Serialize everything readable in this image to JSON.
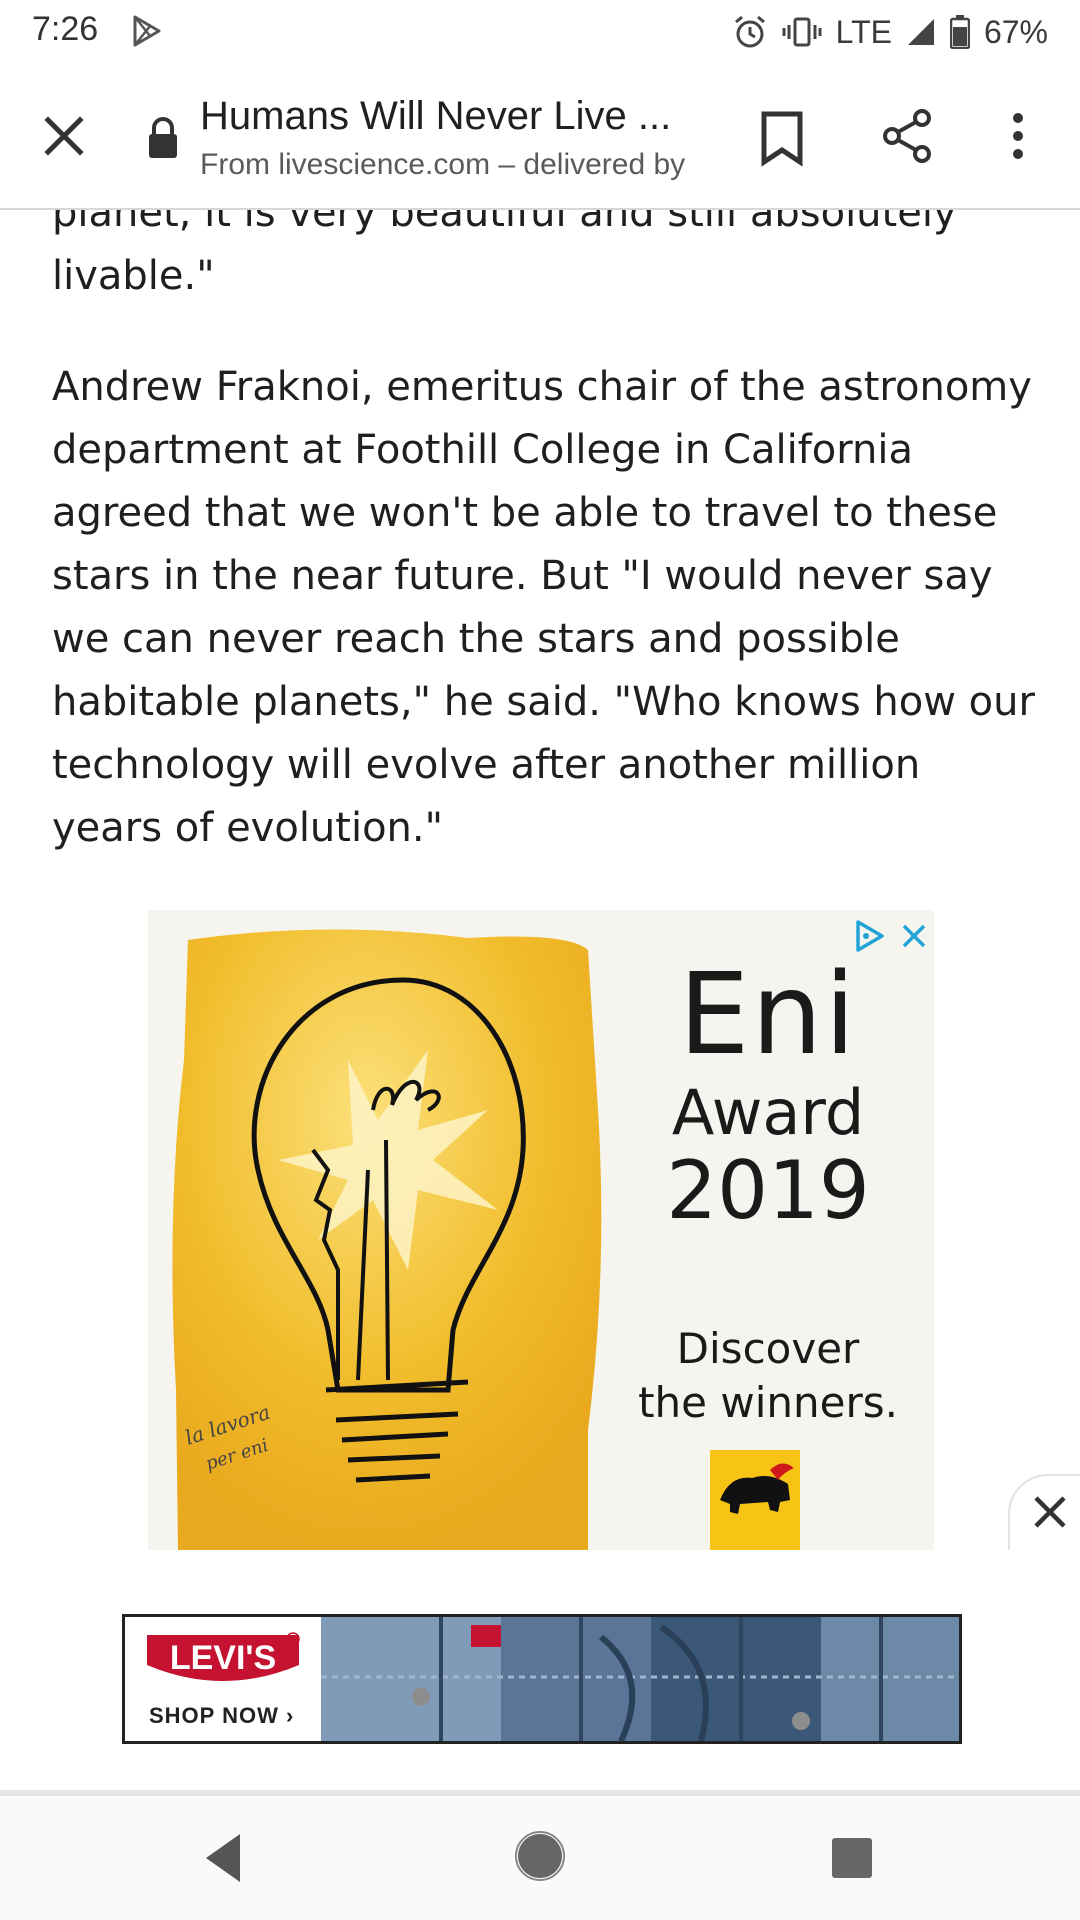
{
  "status_bar": {
    "time": "7:26",
    "network": "LTE",
    "battery": "67%",
    "icons": [
      "play-store-icon",
      "alarm-icon",
      "vibrate-icon",
      "signal-icon",
      "battery-icon"
    ]
  },
  "toolbar": {
    "title": "Humans Will Never Live ...",
    "subtitle": "From livescience.com – delivered by",
    "icons": [
      "close-icon",
      "lock-icon",
      "bookmark-icon",
      "share-icon",
      "more-vert-icon"
    ]
  },
  "article": {
    "paragraphs": [
      "planet, it is very beautiful and still absolutely livable.\"",
      "Andrew Fraknoi, emeritus chair of the astronomy department at Foothill College in California agreed that we won't be able to travel to these stars in the near future. But \"I would never say we can never reach the stars and possible habitable planets,\" he said. \"Who knows how our technology will evolve after another million years of evolution.\""
    ]
  },
  "ad_eni": {
    "brand": "Eni",
    "award": "Award",
    "year": "2019",
    "cta_line1": "Discover",
    "cta_line2": "the winners.",
    "logo_text": "eni",
    "signature": "La lavora per eni"
  },
  "banner_ad": {
    "brand": "LEVI'S",
    "cta": "SHOP NOW ›"
  },
  "nav_bar": {
    "icons": [
      "back-icon",
      "home-icon",
      "recents-icon"
    ]
  },
  "colors": {
    "eni_yellow": "#f2c12e",
    "levis_red": "#c41230",
    "text": "#1f1f1f"
  }
}
